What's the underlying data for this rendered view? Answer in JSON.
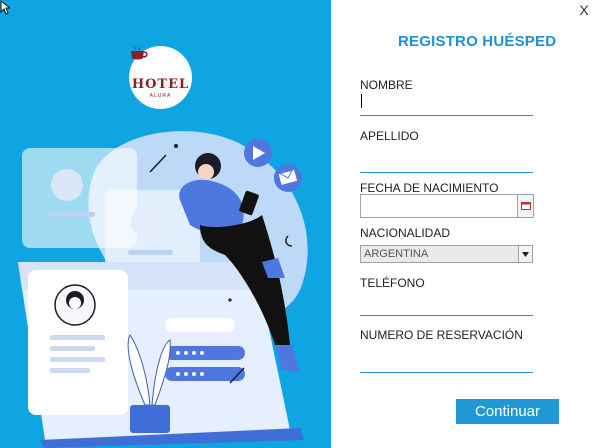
{
  "window": {
    "close_label": "X"
  },
  "logo": {
    "name": "HOTEL",
    "subtitle": "ALURA"
  },
  "form": {
    "title": "REGISTRO HUÉSPED",
    "fields": {
      "nombre": {
        "label": "NOMBRE",
        "value": ""
      },
      "apellido": {
        "label": "APELLIDO",
        "value": ""
      },
      "fecha": {
        "label": "FECHA DE NACIMIENTO",
        "value": ""
      },
      "nacionalidad": {
        "label": "NACIONALIDAD",
        "value": "ARGENTINA"
      },
      "telefono": {
        "label": "TELÉFONO",
        "value": ""
      },
      "reserva": {
        "label": "NUMERO DE RESERVACIÓN",
        "value": ""
      }
    },
    "submit_label": "Continuar"
  },
  "colors": {
    "panel": "#0ea5e2",
    "accent": "#1f90d8",
    "button": "#1f9ad7"
  },
  "icons": [
    "cup-logo-icon",
    "play-icon",
    "mail-icon",
    "calendar-icon",
    "chevron-down-icon",
    "cursor-icon"
  ]
}
